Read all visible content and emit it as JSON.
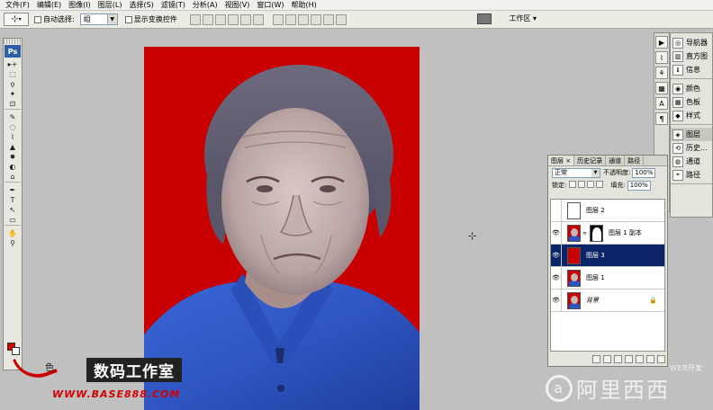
{
  "menu": [
    "文件(F)",
    "编辑(E)",
    "图像(I)",
    "图层(L)",
    "选择(S)",
    "滤镜(T)",
    "分析(A)",
    "视图(V)",
    "窗口(W)",
    "帮助(H)"
  ],
  "options": {
    "auto_select_label": "自动选择:",
    "auto_select_value": "组",
    "show_transform_label": "显示变换控件",
    "workspace_label": "工作区 ▾"
  },
  "toolbox": {
    "logo": "Ps",
    "tools": [
      "▸+",
      "⬚",
      "ϙ",
      "✦",
      "⊡",
      "✎",
      "◌",
      "⌇",
      "▲",
      "✸",
      "◐",
      "⌂",
      "✒",
      "T",
      "↖",
      "▭",
      "✋",
      "⚲"
    ]
  },
  "dock": {
    "groups": [
      [
        {
          "icon": "◎",
          "label": "导航器"
        },
        {
          "icon": "▥",
          "label": "直方图"
        },
        {
          "icon": "ℹ",
          "label": "信息"
        }
      ],
      [
        {
          "icon": "◉",
          "label": "颜色"
        },
        {
          "icon": "▦",
          "label": "色板"
        },
        {
          "icon": "◆",
          "label": "样式"
        }
      ],
      [
        {
          "icon": "◈",
          "label": "图层"
        },
        {
          "icon": "⟲",
          "label": "历史..."
        },
        {
          "icon": "◍",
          "label": "通道"
        },
        {
          "icon": "⌖",
          "label": "路径"
        }
      ]
    ]
  },
  "layers_panel": {
    "tabs": [
      "图层 ×",
      "历史记录",
      "通道",
      "路径"
    ],
    "blend_mode": "正常",
    "opacity_label": "不透明度:",
    "opacity_value": "100%",
    "lock_label": "锁定:",
    "fill_label": "填充:",
    "fill_value": "100%",
    "layers": [
      {
        "name": "图层 2",
        "visible": false,
        "thumb": "white",
        "mask": false,
        "selected": false,
        "locked": false
      },
      {
        "name": "图层 1 副本",
        "visible": true,
        "thumb": "portrait",
        "mask": true,
        "selected": false,
        "locked": false
      },
      {
        "name": "图层 3",
        "visible": true,
        "thumb": "red",
        "mask": false,
        "selected": true,
        "locked": false
      },
      {
        "name": "图层 1",
        "visible": true,
        "thumb": "portrait",
        "mask": false,
        "selected": false,
        "locked": false
      },
      {
        "name": "背景",
        "visible": true,
        "thumb": "portrait",
        "mask": false,
        "selected": false,
        "locked": true
      }
    ]
  },
  "watermark": {
    "brand_mark": "色",
    "brand_title": "数码工作室",
    "brand_url": "WWW.BASE888.COM",
    "web_label": "WEB开发",
    "aliyun_icon": "a",
    "aliyun_text": "阿里西西"
  },
  "colors": {
    "canvas_bg": "#c80000",
    "selected_layer": "#0a246a",
    "foreground": "#d40000",
    "background": "#ffffff"
  }
}
